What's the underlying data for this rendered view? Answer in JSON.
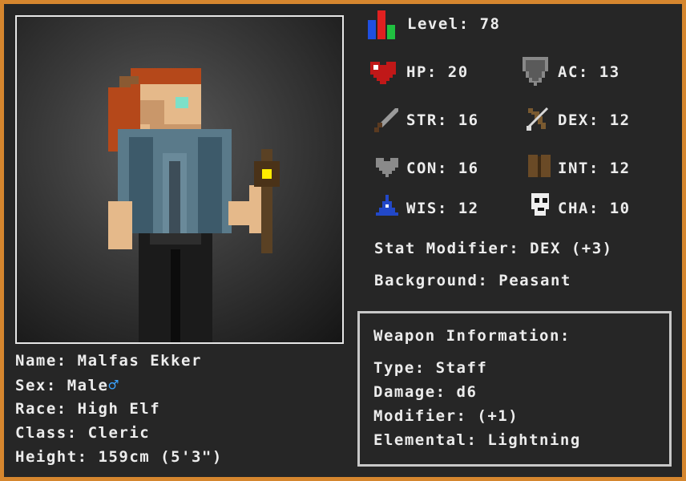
{
  "colors": {
    "frame": "#d5862e",
    "panel": "#262626",
    "text": "#ececec",
    "male_symbol": "#3ba3ff",
    "box_border": "#c8c8c8"
  },
  "character": {
    "name_label": "Name:",
    "name": "Malfas Ekker",
    "sex_label": "Sex:",
    "sex": "Male",
    "sex_symbol": "♂",
    "race_label": "Race:",
    "race": "High Elf",
    "class_label": "Class:",
    "class": "Cleric",
    "height_label": "Height:",
    "height": "159cm (5'3\")"
  },
  "stats": {
    "level_label": "Level:",
    "level": "78",
    "hp_label": "HP:",
    "hp": "20",
    "ac_label": "AC:",
    "ac": "13",
    "str_label": "STR:",
    "str": "16",
    "dex_label": "DEX:",
    "dex": "12",
    "con_label": "CON:",
    "con": "16",
    "int_label": "INT:",
    "int": "12",
    "wis_label": "WIS:",
    "wis": "12",
    "cha_label": "CHA:",
    "cha": "10",
    "stat_modifier_label": "Stat Modifier:",
    "stat_modifier": "DEX (+3)",
    "background_label": "Background:",
    "background": "Peasant"
  },
  "icons": {
    "level": "level-bars-icon",
    "hp": "heart-icon",
    "ac": "shield-icon",
    "str": "sword-icon",
    "dex": "bow-icon",
    "con": "grey-heart-icon",
    "int": "book-icon",
    "wis": "wizard-hat-icon",
    "cha": "skull-mask-icon"
  },
  "weapon": {
    "title": "Weapon Information:",
    "type_label": "Type:",
    "type": "Staff",
    "damage_label": "Damage:",
    "damage": "d6",
    "modifier_label": "Modifier:",
    "modifier": "(+1)",
    "elemental_label": "Elemental:",
    "elemental": "Lightning"
  }
}
